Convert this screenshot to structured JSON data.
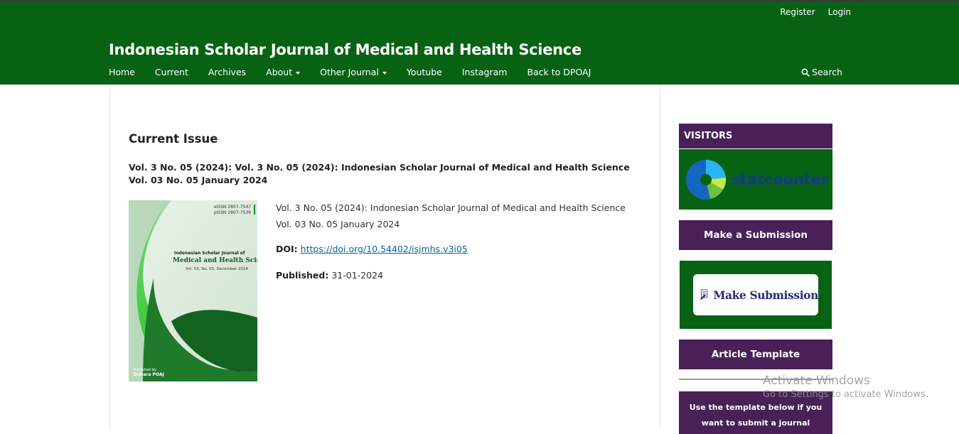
{
  "header": {
    "site_title": "Indonesian Scholar Journal of Medical and Health Science",
    "user_nav": {
      "register": "Register",
      "login": "Login"
    },
    "nav": {
      "home": "Home",
      "current": "Current",
      "archives": "Archives",
      "about": "About",
      "other_journal": "Other Journal",
      "youtube": "Youtube",
      "instagram": "Instagram",
      "back": "Back to DPOAJ"
    },
    "search_label": "Search"
  },
  "main": {
    "heading": "Current Issue",
    "issue_title": "Vol. 3 No. 05 (2024): Vol. 3 No. 05 (2024): Indonesian Scholar Journal of Medical and Health Science Vol. 03 No. 05 January 2024",
    "description": "Vol. 3 No. 05 (2024): Indonesian Scholar Journal of Medical and Health Science Vol. 03 No. 05 January 2024",
    "doi_label": "DOI:",
    "doi_link": "https://doi.org/10.54402/isjmhs.v3i05",
    "published_label": "Published:",
    "published_date": "31-01-2024",
    "cover": {
      "eissn": "eISSN 2807-7547",
      "pissn": "pISSN 2807-7539",
      "title_small": "Indonesian Scholar Journal of",
      "title_large": "Medical and Health Science",
      "volume": "Vol. 03, No. 05, December 2024",
      "published_by": "Published by",
      "publisher": "Dohara POAJ"
    }
  },
  "sidebar": {
    "visitors_title": "VISITORS",
    "statcounter_text": "statcounter",
    "make_submission_button": "Make a Submission",
    "make_submission_banner": "Make Submission",
    "article_template_button": "Article Template",
    "template_note_line1": "Use the template below if you",
    "template_note_line2": "want to submit a journal"
  },
  "overlay": {
    "activate_title": "Activate Windows",
    "activate_sub": "Go to Settings to activate Windows."
  },
  "colors": {
    "header_green": "#086213",
    "sidebar_purple": "#4a2058",
    "link_blue": "#006798"
  }
}
